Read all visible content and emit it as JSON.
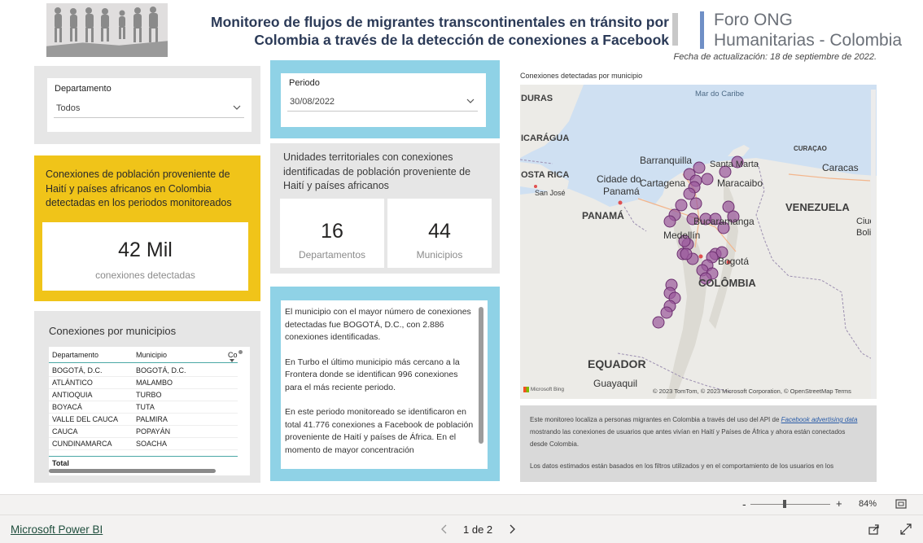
{
  "header": {
    "title_line1": "Monitoreo de flujos de migrantes transcontinentales en tránsito por",
    "title_line2": "Colombia a través de la detección de conexiones a Facebook",
    "org_line1": "Foro ONG",
    "org_line2": "Humanitarias - Colombia",
    "updated": "Fecha de actualización: 18 de septiembre de 2022."
  },
  "slicers": {
    "departamento": {
      "label": "Departamento",
      "value": "Todos"
    },
    "periodo": {
      "label": "Periodo",
      "value": "30/08/2022"
    }
  },
  "kpi": {
    "title": "Conexiones de población proveniente de Haití y países africanos en Colombia detectadas en los periodos monitoreados",
    "value": "42 Mil",
    "unit": "conexiones detectadas"
  },
  "units": {
    "title": "Unidades territoriales con conexiones identificadas de población proveniente de Haití y países africanos",
    "departamentos_value": "16",
    "departamentos_label": "Departamentos",
    "municipios_value": "44",
    "municipios_label": "Municipios"
  },
  "table": {
    "title": "Conexiones por municipios",
    "columns": [
      "Departamento",
      "Municipio",
      "Co"
    ],
    "rows": [
      [
        "BOGOTÁ, D.C.",
        "BOGOTÁ, D.C."
      ],
      [
        "ATLÁNTICO",
        "MALAMBO"
      ],
      [
        "ANTIOQUIA",
        "TURBO"
      ],
      [
        "BOYACÁ",
        "TUTA"
      ],
      [
        "VALLE DEL CAUCA",
        "PALMIRA"
      ],
      [
        "CAUCA",
        "POPAYÁN"
      ],
      [
        "CUNDINAMARCA",
        "SOACHA"
      ]
    ],
    "total_label": "Total"
  },
  "narrative": {
    "p1": "El municipio con el mayor número de conexiones detectadas fue BOGOTÁ, D.C., con 2.886 conexiones identificadas.",
    "p2": "En Turbo el último municipio más cercano a la Frontera donde se identifican 996 conexiones para el más reciente periodo.",
    "p3": "En este periodo monitoreado se identificaron en total 41.776 conexiones a Facebook de población proveniente de Haití y países de África. En el momento de mayor concentración"
  },
  "map": {
    "title": "Conexiones detectadas por municipio",
    "attribution": "© 2023 TomTom, © 2023 Microsoft Corporation, © OpenStreetMap  Terms",
    "bing": "Microsoft Bing",
    "labels": {
      "honduras": "DURAS",
      "nicaragua": "ICARÁGUA",
      "costarica": "OSTA RICA",
      "sanjose": "San José",
      "caribe": "Mar do Caribe",
      "curacao": "CURAÇAO",
      "barranquilla": "Barranquilla",
      "santamarta": "Santa Marta",
      "caracas": "Caracas",
      "maracaibo": "Maracaibo",
      "cartagena": "Cartagena",
      "cidade": "Cidade do",
      "panamacity": "Panamá",
      "panama": "PANAMÁ",
      "venezuela": "VENEZUELA",
      "ciud": "Ciud",
      "boliv": "Boliv",
      "bucaramanga": "Bucaramanga",
      "medellin": "Medellín",
      "bogota": "Bogotá",
      "colombia": "COLÔMBIA",
      "ecuador": "EQUADOR",
      "guayaquil": "Guayaquil"
    },
    "marker_color": "#9b5a9c"
  },
  "info": {
    "p1_before": "Este monitoreo localiza a personas migrantes en Colombia a través del uso del API de ",
    "p1_link": "Facebook advertising data",
    "p1_after": " mostrando las conexiones de usuarios que antes vivían en Haití y Países de África y ahora están conectados desde Colombia.",
    "p2": "Los datos estimados están basados en los filtros utilizados y en el comportamiento de los usuarios en los"
  },
  "zoom": {
    "minus": "-",
    "plus": "+",
    "level": "84%"
  },
  "footer": {
    "brand": "Microsoft Power BI",
    "page": "1 de 2"
  }
}
